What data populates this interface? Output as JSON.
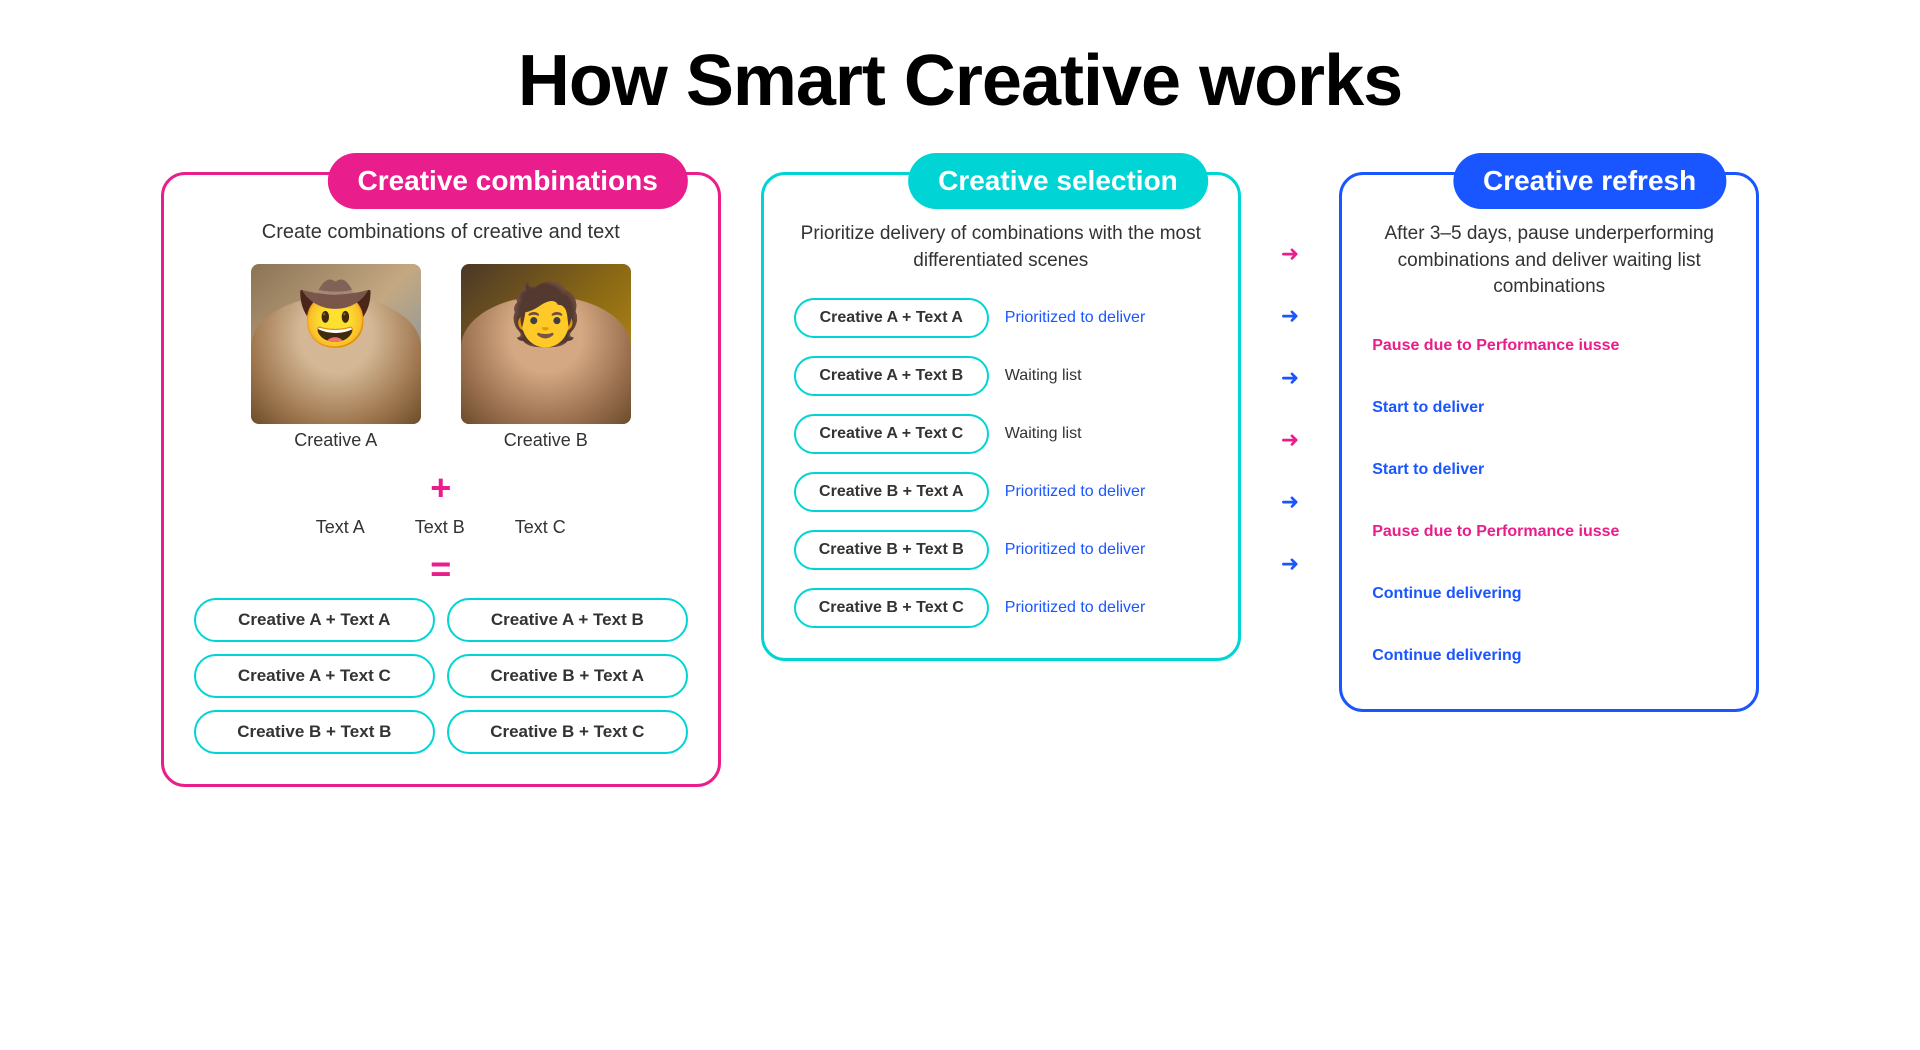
{
  "page": {
    "title": "How Smart Creative works"
  },
  "panel1": {
    "badge": "Creative combinations",
    "subtitle": "Create combinations of creative and text",
    "creative_a_label": "Creative A",
    "creative_b_label": "Creative B",
    "plus": "+",
    "equals": "=",
    "text_labels": [
      "Text A",
      "Text B",
      "Text C"
    ],
    "combinations": [
      "Creative A + Text A",
      "Creative A + Text B",
      "Creative A + Text C",
      "Creative B + Text A",
      "Creative B + Text B",
      "Creative B + Text C"
    ]
  },
  "panel2": {
    "badge": "Creative selection",
    "description": "Prioritize delivery of combinations with the most differentiated scenes",
    "rows": [
      {
        "label": "Creative A + Text A",
        "status": "Prioritized to deliver",
        "prioritized": true
      },
      {
        "label": "Creative A + Text B",
        "status": "Waiting list",
        "prioritized": false
      },
      {
        "label": "Creative A + Text C",
        "status": "Waiting list",
        "prioritized": false
      },
      {
        "label": "Creative B + Text A",
        "status": "Prioritized to deliver",
        "prioritized": true
      },
      {
        "label": "Creative B + Text B",
        "status": "Prioritized to deliver",
        "prioritized": true
      },
      {
        "label": "Creative B + Text C",
        "status": "Prioritized to deliver",
        "prioritized": true
      }
    ]
  },
  "panel3": {
    "badge": "Creative refresh",
    "description": "After 3–5 days, pause underperforming combinations and deliver waiting list combinations",
    "rows": [
      {
        "action": "Pause due to Performance iusse",
        "color": "red",
        "arrow_color": "red"
      },
      {
        "action": "Start to deliver",
        "color": "blue",
        "arrow_color": "blue"
      },
      {
        "action": "Start to deliver",
        "color": "blue",
        "arrow_color": "blue"
      },
      {
        "action": "Pause due to Performance iusse",
        "color": "red",
        "arrow_color": "red"
      },
      {
        "action": "Continue delivering",
        "color": "blue",
        "arrow_color": "blue"
      },
      {
        "action": "Continue delivering",
        "color": "blue",
        "arrow_color": "blue"
      }
    ]
  }
}
